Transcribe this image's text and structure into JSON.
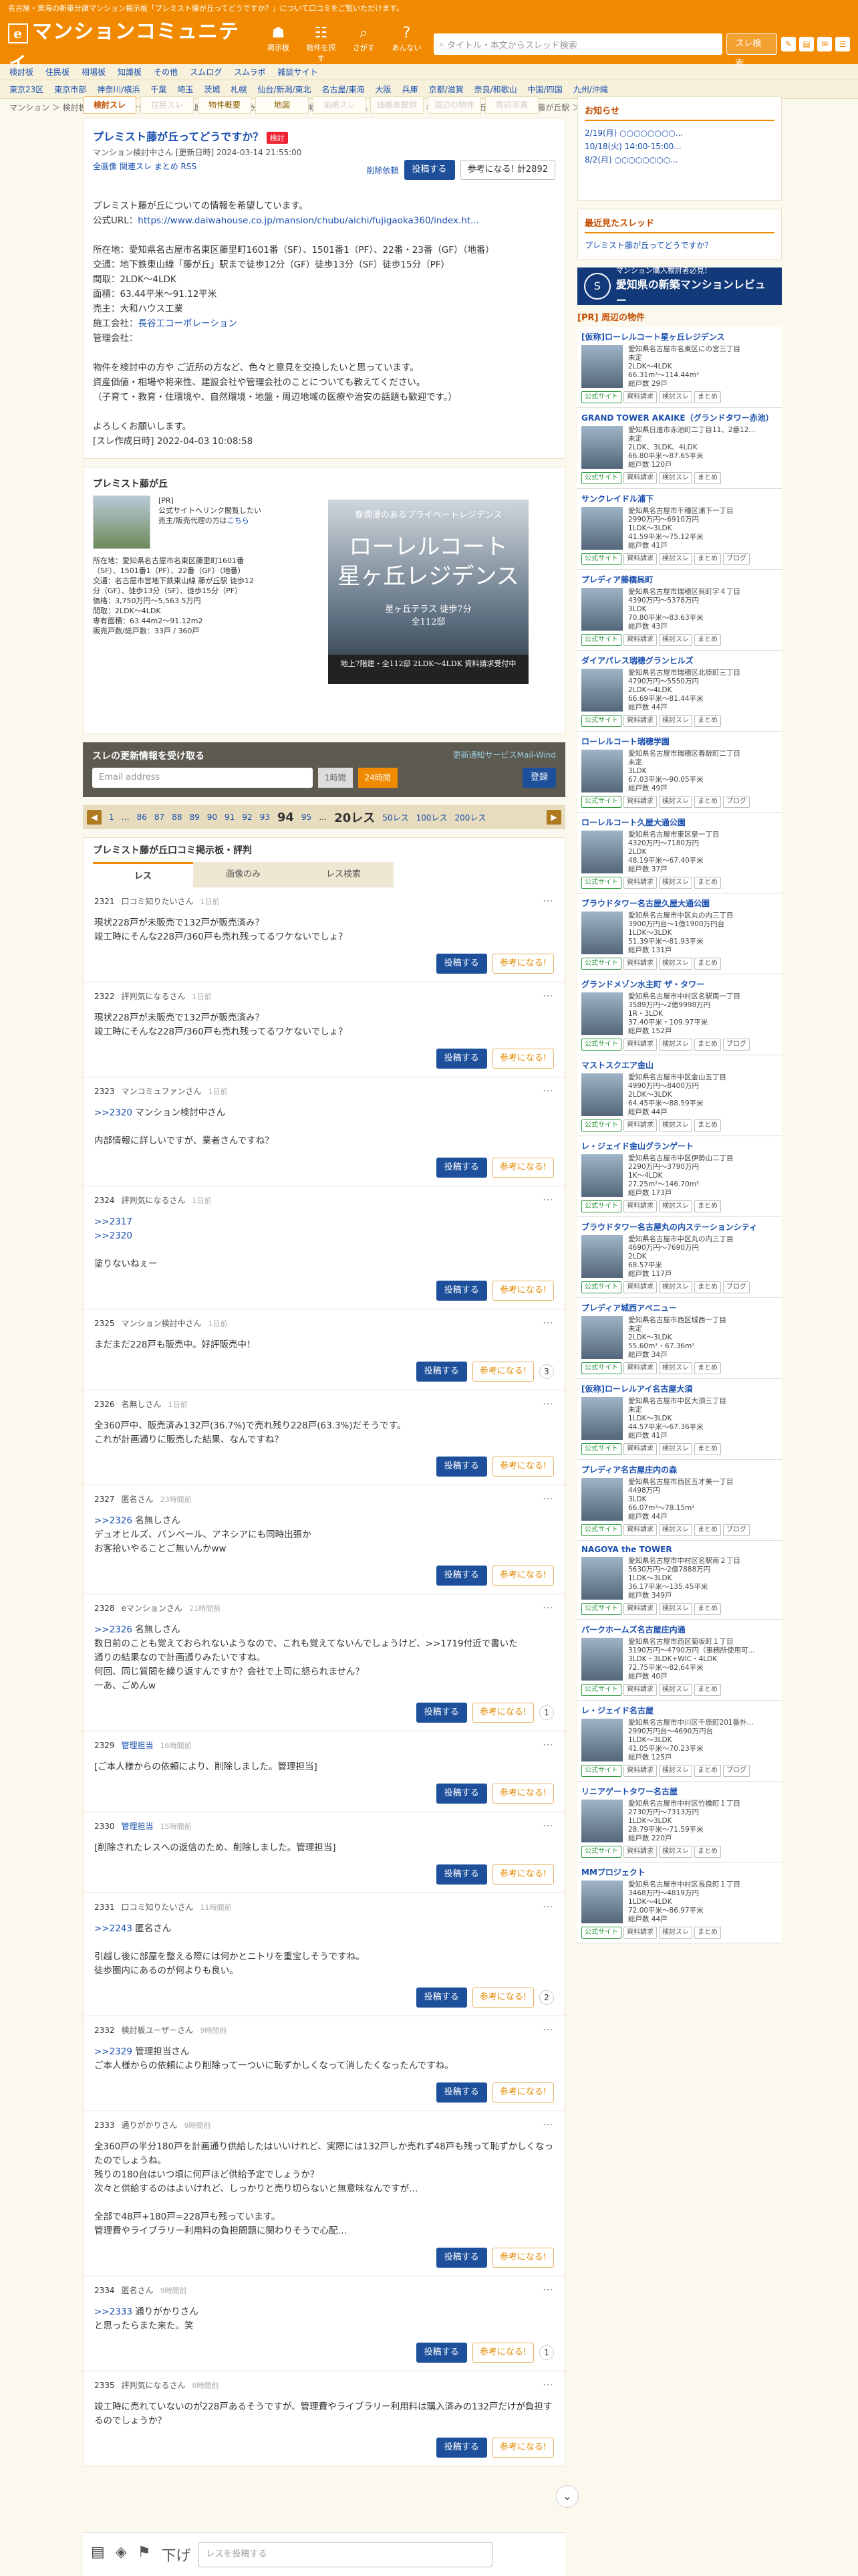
{
  "topbar": {
    "notice": "名古屋・東海の新築分譲マンション掲示板「プレミスト藤が丘ってどうですか？」について口コミをご覧いただけます。",
    "logo": "マンションコミュニティ",
    "logo_mark": "e",
    "nav": [
      {
        "g": "☗",
        "label": "掲示板"
      },
      {
        "g": "☷",
        "label": "物件を探す"
      },
      {
        "g": "⌕",
        "label": "さがす"
      },
      {
        "g": "?",
        "label": "あんない"
      }
    ],
    "search_placeholder": "タイトル・本文からスレッド検索",
    "search_btn": "スレ検索",
    "right": [
      "✎",
      "▤",
      "✉",
      "☰"
    ]
  },
  "navbar": [
    "検討板",
    "住民板",
    "相場板",
    "知識板",
    "その他",
    "スムログ",
    "スムラボ",
    "雑談サイト"
  ],
  "regions": [
    "東京23区",
    "東京市部",
    "神奈川/横浜",
    "千葉",
    "埼玉",
    "茨城",
    "札幌",
    "仙台/新潟/東北",
    "名古屋/東海",
    "大阪",
    "兵庫",
    "京都/滋賀",
    "奈良/和歌山",
    "中国/四国",
    "九州/沖縄"
  ],
  "breadcrumb": "マンション ＞ 検討板(新築分譲マンション) ＞ 名古屋・東海の新築分譲マンション掲示板 ＞ 愛知県 ＞ 名古屋市 ＞ 名東区 ＞ 藤が丘 ＞ 猪高町 ＞ 藤が丘駅 ＞ プレミスト藤が丘ってどうですか？",
  "tabs": [
    {
      "label": "検討スレ",
      "state": "on"
    },
    {
      "label": "住民スレ",
      "state": "off"
    },
    {
      "label": "物件概要",
      "state": ""
    },
    {
      "label": "地図",
      "state": ""
    },
    {
      "label": "価格スレ",
      "state": "off"
    },
    {
      "label": "価格表提供",
      "state": "off"
    },
    {
      "label": "周辺の物件",
      "state": "off"
    },
    {
      "label": "周辺写真",
      "state": "off"
    }
  ],
  "thread": {
    "title": "プレミスト藤が丘ってどうですか？",
    "badge": "検討",
    "meta": "マンション検討中さん [更新日時] 2024-03-14 21:55:00",
    "links": [
      "全画像",
      "関連スレ",
      "まとめ",
      "RSS"
    ],
    "delete_req": "削除依頼",
    "post_btn": "投稿する",
    "ref_btn": "参考になる!",
    "ref_count": "計2892",
    "body": [
      "プレミスト藤が丘についての情報を希望しています。",
      "公式URL：",
      "",
      "所在地：愛知県名古屋市名東区藤里町1601番（SF）、1501番1（PF）、22番・23番（GF）（地番）",
      "交通：地下鉄東山線「藤が丘」駅まで徒歩12分（GF）徒歩13分（SF）徒歩15分（PF）",
      "間取：2LDK～4LDK",
      "面積：63.44平米～91.12平米",
      "売主：大和ハウス工業",
      "施工会社：",
      "管理会社：",
      "",
      "物件を検討中の方や ご近所の方など、色々と意見を交換したいと思っています。",
      "資産価値・相場や将来性、建設会社や管理会社のことについても教えてください。",
      "（子育て・教育・住環境や、自然環境・地盤・周辺地域の医療や治安の話題も歓迎です。）",
      "",
      "よろしくお願いします。",
      "[スレ作成日時] 2022-04-03 10:08:58"
    ],
    "url": "https://www.daiwahouse.co.jp/mansion/chubu/aichi/fujigaoka360/index.ht...",
    "builder": "長谷工コーポレーション"
  },
  "property": {
    "title": "プレミスト藤が丘",
    "pr": "[PR]",
    "pr_text": "公式サイトへリンク閲覧したい",
    "pr_text2": "売主/販売代理の方は",
    "pr_link": "こちら",
    "address": "所在地：愛知県名古屋市名東区藤里町1601番（SF）、1501番1（PF）、22番（GF）（地番）",
    "access": "交通：名古屋市営地下鉄東山線 藤が丘駅 徒歩12分（GF）、徒歩13分（SF）、徒歩15分（PF）",
    "price": "価格：3,750万円～5,563.5万円",
    "layout": "間取：2LDK～4LDK",
    "area": "専有面積：63.44m2～91.12m2",
    "units": "販売戸数/総戸数：33戸 / 360戸"
  },
  "ad": {
    "top": "春爛漫のあるプライベートレジデンス",
    "name1": "ローレルコート",
    "name2": "星ヶ丘レジデンス",
    "mid": "全112邸",
    "sub": "星ヶ丘テラス 徒歩7分",
    "foot": "地上7階建・全112邸 2LDK～4LDK 資料請求受付中"
  },
  "mail": {
    "title": "スレの更新情報を受け取る",
    "link": "更新通知サービスMail-Wind",
    "placeholder": "Email address",
    "opt1": "1時間",
    "opt2": "24時間",
    "btn": "登録"
  },
  "pager": {
    "items": [
      "1",
      "…",
      "86",
      "87",
      "88",
      "89",
      "90",
      "91",
      "92",
      "93"
    ],
    "cur": "94",
    "next": "95",
    "tail": "…",
    "count": "20レス",
    "opts": [
      "50レス",
      "100レス",
      "200レス"
    ]
  },
  "reviews": {
    "title": "プレミスト藤が丘口コミ掲示板・評判",
    "tabs": [
      "レス",
      "画像のみ",
      "レス検索"
    ]
  },
  "posts": [
    {
      "no": "2321",
      "auth": "口コミ知りたいさん",
      "stf": "",
      "tm": "1日前",
      "tx": "現状228戸が未販売で132戸が販売済み？\n竣工時にそんな228戸/360戸も売れ残ってるワケないでしょ？",
      "cnt": ""
    },
    {
      "no": "2322",
      "auth": "評判気になるさん",
      "stf": "",
      "tm": "1日前",
      "tx": "現状228戸が未販売で132戸が販売済み？\n竣工時にそんな228戸/360戸も売れ残ってるワケないでしょ？",
      "cnt": ""
    },
    {
      "no": "2323",
      "auth": "マンコミュファンさん",
      "stf": "",
      "tm": "1日前",
      "tx": ">>2320 マンション検討中さん\n\n内部情報に詳しいですが、業者さんですね？",
      "cnt": ""
    },
    {
      "no": "2324",
      "auth": "評判気になるさん",
      "stf": "",
      "tm": "1日前",
      "tx": ">>2317\n>>2320\n\n塗りないねぇー",
      "cnt": ""
    },
    {
      "no": "2325",
      "auth": "マンション検討中さん",
      "stf": "",
      "tm": "1日前",
      "tx": "まだまだ228戸も販売中。好評販売中！",
      "cnt": "3"
    },
    {
      "no": "2326",
      "auth": "名無しさん",
      "stf": "",
      "tm": "1日前",
      "tx": "全360戸中、販売済み132戸(36.7%)で売れ残り228戸(63.3%)だそうです。\nこれが計画通りに販売した結果、なんですね？",
      "cnt": ""
    },
    {
      "no": "2327",
      "auth": "匿名さん",
      "stf": "",
      "tm": "23時間前",
      "tx": ">>2326 名無しさん\nデュオヒルズ、バンベール、アネシアにも同時出張か\nお客拾いやることご無いんかww",
      "cnt": ""
    },
    {
      "no": "2328",
      "auth": "eマンションさん",
      "stf": "",
      "tm": "21時間前",
      "tx": ">>2326 名無しさん\n数日前のことも覚えておられないようなので、これも覚えてないんでしょうけど、>>1719付近で書いた\n通りの結果なので計画通りみたいですね。\n何回、同じ質問を繰り返すんですか？会社で上司に怒られません？\n一あ、ごめんw",
      "cnt": "1"
    },
    {
      "no": "2329",
      "auth": "",
      "stf": "管理担当",
      "tm": "16時間前",
      "tx": "[ご本人様からの依頼により、削除しました。管理担当]",
      "cnt": ""
    },
    {
      "no": "2330",
      "auth": "",
      "stf": "管理担当",
      "tm": "15時間前",
      "tx": "[削除されたレスへの返信のため、削除しました。管理担当]",
      "cnt": ""
    },
    {
      "no": "2331",
      "auth": "口コミ知りたいさん",
      "stf": "",
      "tm": "11時間前",
      "tx": ">>2243 匿名さん\n\n引越し後に部屋を整える際には何かとニトリを重宝しそうですね。\n徒歩圏内にあるのが何よりも良い。",
      "cnt": "2"
    },
    {
      "no": "2332",
      "auth": "検討板ユーザーさん",
      "stf": "",
      "tm": "9時間前",
      "tx": ">>2329 管理担当さん\nご本人様からの依頼により削除って一ついに恥ずかしくなって消したくなったんですね。",
      "cnt": ""
    },
    {
      "no": "2333",
      "auth": "通りがかりさん",
      "stf": "",
      "tm": "9時間前",
      "tx": "全360戸の半分180戸を計画通り供給したはいいけれど、実際には132戸しか売れず48戸も残って恥ずかしくなったのでしょうね。\n残りの180台はいつ頃に何戸ほど供給予定でしょうか？\n次々と供給するのはよいけれど、しっかりと売り切らないと無意味なんですが…\n\n全部で48戸+180戸=228戸も残っています。\n管理費やライブラリー利用料の負担問題に関わりそうで心配…",
      "cnt": ""
    },
    {
      "no": "2334",
      "auth": "匿名さん",
      "stf": "",
      "tm": "9時間前",
      "tx": ">>2333 通りがかりさん\nと思ったらまた来た。笑",
      "cnt": "1"
    },
    {
      "no": "2335",
      "auth": "評判気になるさん",
      "stf": "",
      "tm": "8時間前",
      "tx": "竣工時に売れていないのが228戸あるそうですが、管理費やライブラリー利用料は購入済みの132戸だけが負担するのでしょうか？",
      "cnt": ""
    }
  ],
  "sidebar": {
    "notice_title": "お知らせ",
    "notices": [
      "2/19(月) ○○○○○○○○...",
      "10/18(火) 14:00-15:00...",
      "8/2(月) ○○○○○○○○..."
    ],
    "recent_title": "最近見たスレッド",
    "recent": [
      "プレミスト藤が丘ってどうですか？"
    ],
    "banner_t1": "マンション購入検討者必見！",
    "banner_logo": "S",
    "banner_t2": "愛知県の新築マンションレビュー",
    "pr": "[PR] 周辺の物件",
    "items": [
      {
        "name": "[仮称]ローレルコート星ヶ丘レジデンス",
        "info": [
          "愛知県名古屋市名東区にの宮三丁目",
          "未定",
          "2LDK～4LDK",
          "66.31m²～114.44m²",
          "総戸数 29戸"
        ]
      },
      {
        "name": "GRAND TOWER AKAIKE（グランドタワー赤池）",
        "info": [
          "愛知県日進市赤池町二丁目11、2番12...",
          "未定",
          "2LDK、3LDK、4LDK",
          "66.80平米～87.65平米",
          "総戸数 120戸"
        ]
      },
      {
        "name": "サンクレイドル浦下",
        "info": [
          "愛知県名古屋市千種区浦下一丁目",
          "2990万円～6910万円",
          "1LDK～3LDK",
          "41.59平米～75.12平米",
          "総戸数 41戸"
        ]
      },
      {
        "name": "プレディア藤橋呉町",
        "info": [
          "愛知県名古屋市瑞穂区呉町字４丁目",
          "4390万円～5378万円",
          "3LDK",
          "70.80平米～83.63平米",
          "総戸数 43戸"
        ]
      },
      {
        "name": "ダイアパレス瑞穂グランヒルズ",
        "info": [
          "愛知県名古屋市瑞穂区北原町三丁目",
          "4790万円～5550万円",
          "2LDK～4LDK",
          "66.69平米～81.44平米",
          "総戸数 44戸"
        ]
      },
      {
        "name": "ローレルコート瑞穂学園",
        "info": [
          "愛知県名古屋市瑞穂区春敲町二丁目",
          "未定",
          "3LDK",
          "67.03平米～90.05平米",
          "総戸数 49戸"
        ]
      },
      {
        "name": "ローレルコート久屋大通公園",
        "info": [
          "愛知県名古屋市東区泉一丁目",
          "4320万円～7180万円",
          "2LDK",
          "48.19平米～67.40平米",
          "総戸数 37戸"
        ]
      },
      {
        "name": "ブラウドタワー名古屋久屋大通公園",
        "info": [
          "愛知県名古屋市中区丸の内三丁目",
          "3900万円台～1億1900万円台",
          "1LDK～3LDK",
          "51.39平米～81.93平米",
          "総戸数 131戸"
        ]
      },
      {
        "name": "グランドメゾン水主町 ザ・タワー",
        "info": [
          "愛知県名古屋市中村区名駅南一丁目",
          "3589万円～2億9998万円",
          "1R・3LDK",
          "37.40平米・109.97平米",
          "総戸数 152戸"
        ]
      },
      {
        "name": "マストスクエア金山",
        "info": [
          "愛知県名古屋市中区金山五丁目",
          "4990万円～8400万円",
          "2LDK～3LDK",
          "64.45平米～88.59平米",
          "総戸数 44戸"
        ]
      },
      {
        "name": "レ・ジェイド金山グランゲート",
        "info": [
          "愛知県名古屋市中区伊勢山二丁目",
          "2290万円～3790万円",
          "1K～4LDK",
          "27.25m²～146.70m²",
          "総戸数 173戸"
        ]
      },
      {
        "name": "ブラウドタワー名古屋丸の内ステーションシティ",
        "info": [
          "愛知県名古屋市中区丸の内三丁目",
          "4690万円～7690万円",
          "2LDK",
          "68.57平米",
          "総戸数 117戸"
        ]
      },
      {
        "name": "プレディア城西アベニュー",
        "info": [
          "愛知県名古屋市西区城西一丁目",
          "未定",
          "2LDK～3LDK",
          "55.60m²・67.36m²",
          "総戸数 34戸"
        ]
      },
      {
        "name": "[仮称]ローレルアイ名古屋大須",
        "info": [
          "愛知県名古屋市中区大須三丁目",
          "未定",
          "1LDK～3LDK",
          "44.57平米～67.36平米",
          "総戸数 41戸"
        ]
      },
      {
        "name": "プレディア名古屋庄内の森",
        "info": [
          "愛知県名古屋市西区五才美一丁目",
          "4498万円",
          "3LDK",
          "66.07m²～78.15m²",
          "総戸数 44戸"
        ]
      },
      {
        "name": "NAGOYA the TOWER",
        "info": [
          "愛知県名古屋市中村区名駅南２丁目",
          "5630万円～2億7888万円",
          "1LDK～3LDK",
          "36.17平米～135.45平米",
          "総戸数 349戸"
        ]
      },
      {
        "name": "パークホームズ名古屋庄内通",
        "info": [
          "愛知県名古屋市西区菊坂町１丁目",
          "3190万円～4790万円（事務所使用可...",
          "3LDK・3LDK+WIC・4LDK",
          "72.75平米～82.64平米",
          "総戸数 40戸"
        ]
      },
      {
        "name": "レ・ジェイド名古屋",
        "info": [
          "愛知県名古屋市中川区千原町201番外...",
          "2990万円台～4690万円台",
          "1LDK～3LDK",
          "41.05平米～70.23平米",
          "総戸数 125戸"
        ]
      },
      {
        "name": "リニアゲートタワー名古屋",
        "info": [
          "愛知県名古屋市中村区竹橋町１丁目",
          "2730万円～7313万円",
          "1LDK～3LDK",
          "28.79平米～71.59平米",
          "総戸数 220戸"
        ]
      },
      {
        "name": "MMプロジェクト",
        "info": [
          "愛知県名古屋市中村区長良町１丁目",
          "3468万円～4819万円",
          "1LDK～4LDK",
          "72.00平米～86.97平米",
          "総戸数 44戸"
        ]
      }
    ],
    "btns": [
      "公式サイト",
      "資料請求",
      "検討スレ",
      "まとめ"
    ],
    "blog": "ブログ"
  },
  "bottom": {
    "icons": [
      "▤",
      "◈",
      "⚑",
      "下げ"
    ],
    "placeholder": "レスを投稿する",
    "scroll": "⌄"
  }
}
